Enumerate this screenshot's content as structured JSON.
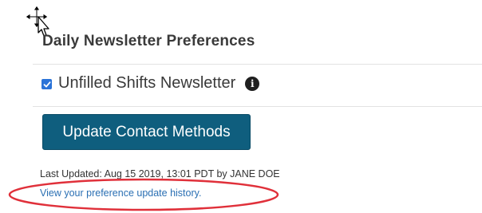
{
  "preferences": {
    "title": "Daily Newsletter Preferences",
    "newsletter_checkbox": {
      "label": "Unfilled Shifts Newsletter",
      "checked": true,
      "info_icon": "info-circle-icon"
    },
    "update_button_label": "Update Contact Methods",
    "last_updated_text": "Last Updated: Aug 15 2019, 13:01 PDT by JANE DOE",
    "history_link_text": "View your preference update history."
  },
  "colors": {
    "button_bg": "#0f5e7e",
    "checkbox_bg": "#2a73d8",
    "link": "#2a6fb3",
    "annotation": "#e0303a"
  }
}
